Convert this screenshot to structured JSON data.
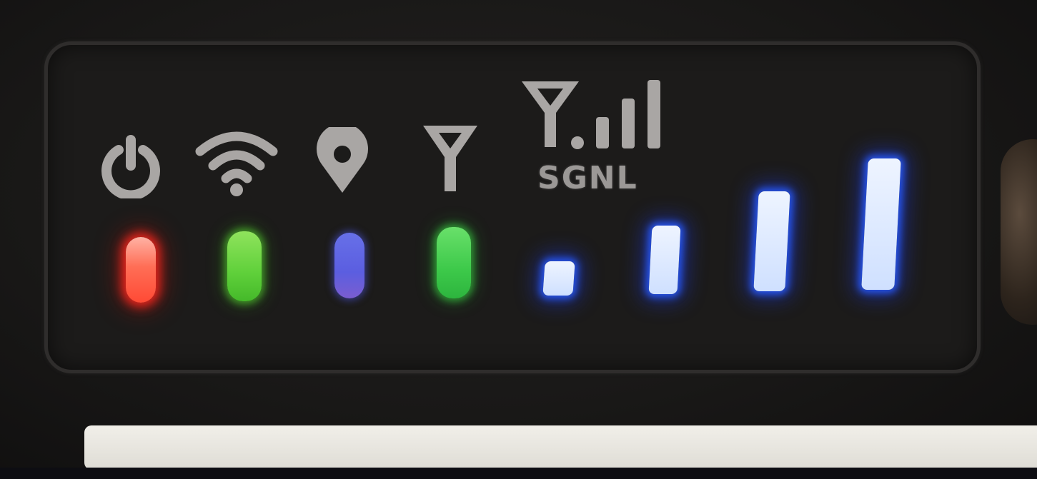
{
  "panel": {
    "indicators": [
      {
        "icon": "power-icon",
        "led_color": "#ff4a35"
      },
      {
        "icon": "wifi-icon",
        "led_color": "#5fd03a"
      },
      {
        "icon": "location-pin-icon",
        "led_color": "#5b5ee0"
      },
      {
        "icon": "antenna-icon",
        "led_color": "#3dc94a"
      }
    ],
    "signal": {
      "label": "SGNL",
      "icon": "signal-strength-icon",
      "bars_lit": 4,
      "bars_total": 4,
      "bar_color": "#dbe7ff"
    }
  }
}
